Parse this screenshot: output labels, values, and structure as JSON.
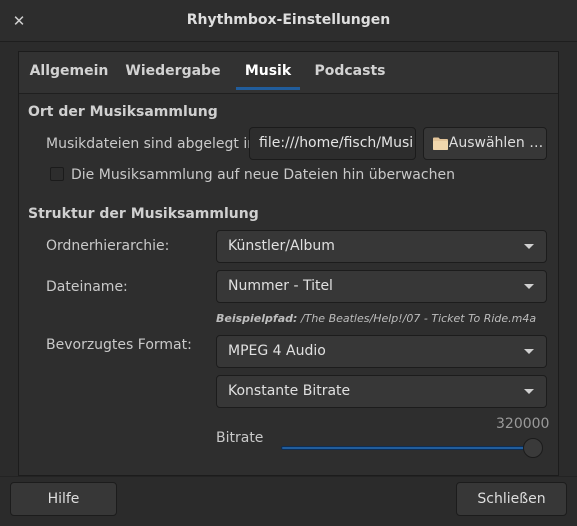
{
  "window": {
    "title": "Rhythmbox-Einstellungen",
    "close_symbol": "✕"
  },
  "tabs": [
    {
      "label": "Allgemein",
      "active": false
    },
    {
      "label": "Wiedergabe",
      "active": false
    },
    {
      "label": "Musik",
      "active": true
    },
    {
      "label": "Podcasts",
      "active": false
    }
  ],
  "location": {
    "section_title": "Ort der Musiksammlung",
    "path_label": "Musikdateien sind abgelegt in:",
    "path_value": "file:///home/fisch/Musi",
    "choose_button": "Auswählen …",
    "watch_label": "Die Musiksammlung auf neue Dateien hin überwachen",
    "watch_checked": false
  },
  "structure": {
    "section_title": "Struktur der Musiksammlung",
    "folder_label": "Ordnerhierarchie:",
    "folder_value": "Künstler/Album",
    "filename_label": "Dateiname:",
    "filename_value": "Nummer - Titel",
    "example_label": "Beispielpfad:",
    "example_value": " /The Beatles/Help!/07 - Ticket To Ride.m4a",
    "format_label": "Bevorzugtes Format:",
    "format_value": "MPEG 4 Audio",
    "preset_value": "Konstante Bitrate",
    "bitrate_label": "Bitrate",
    "bitrate_value": "320000",
    "bitrate_fraction": 1.0
  },
  "footer": {
    "help_button": "Hilfe",
    "close_button": "Schließen"
  },
  "colors": {
    "accent": "#215d9c",
    "background": "#2b2b2b"
  }
}
